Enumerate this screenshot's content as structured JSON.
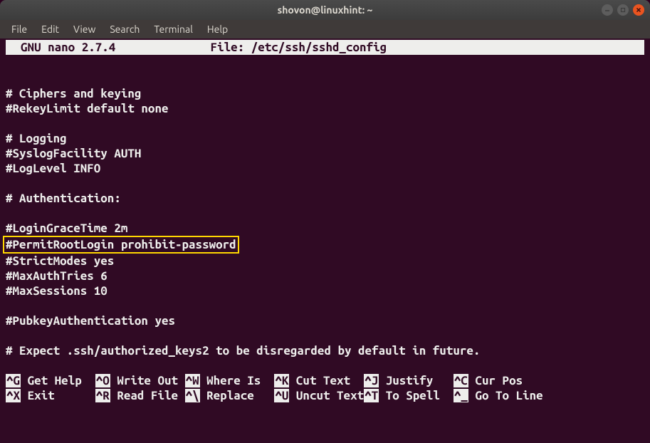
{
  "window": {
    "title": "shovon@linuxhint: ~"
  },
  "menubar": {
    "file": "File",
    "edit": "Edit",
    "view": "View",
    "search": "Search",
    "terminal": "Terminal",
    "help": "Help"
  },
  "nano": {
    "header_app": "  GNU nano 2.7.4",
    "header_file": "File: /etc/ssh/sshd_config"
  },
  "file_lines": {
    "l0": "",
    "l1": "",
    "l2": "# Ciphers and keying",
    "l3": "#RekeyLimit default none",
    "l4": "",
    "l5": "# Logging",
    "l6": "#SyslogFacility AUTH",
    "l7": "#LogLevel INFO",
    "l8": "",
    "l9": "# Authentication:",
    "l10": "",
    "l11": "#LoginGraceTime 2m",
    "l12": "#PermitRootLogin prohibit-password",
    "l13": "#StrictModes yes",
    "l14": "#MaxAuthTries 6",
    "l15": "#MaxSessions 10",
    "l16": "",
    "l17": "#PubkeyAuthentication yes",
    "l18": "",
    "l19": "# Expect .ssh/authorized_keys2 to be disregarded by default in future.",
    "l20": ""
  },
  "shortcuts": {
    "g_key": "^G",
    "g_label": " Get Help  ",
    "o_key": "^O",
    "o_label": " Write Out ",
    "w_key": "^W",
    "w_label": " Where Is  ",
    "k_key": "^K",
    "k_label": " Cut Text  ",
    "j_key": "^J",
    "j_label": " Justify   ",
    "c_key": "^C",
    "c_label": " Cur Pos",
    "x_key": "^X",
    "x_label": " Exit      ",
    "r_key": "^R",
    "r_label": " Read File ",
    "bs_key": "^\\",
    "bs_label": " Replace   ",
    "u_key": "^U",
    "u_label": " Uncut Text",
    "t_key": "^T",
    "t_label": " To Spell  ",
    "ln_key": "^_",
    "ln_label": " Go To Line"
  }
}
